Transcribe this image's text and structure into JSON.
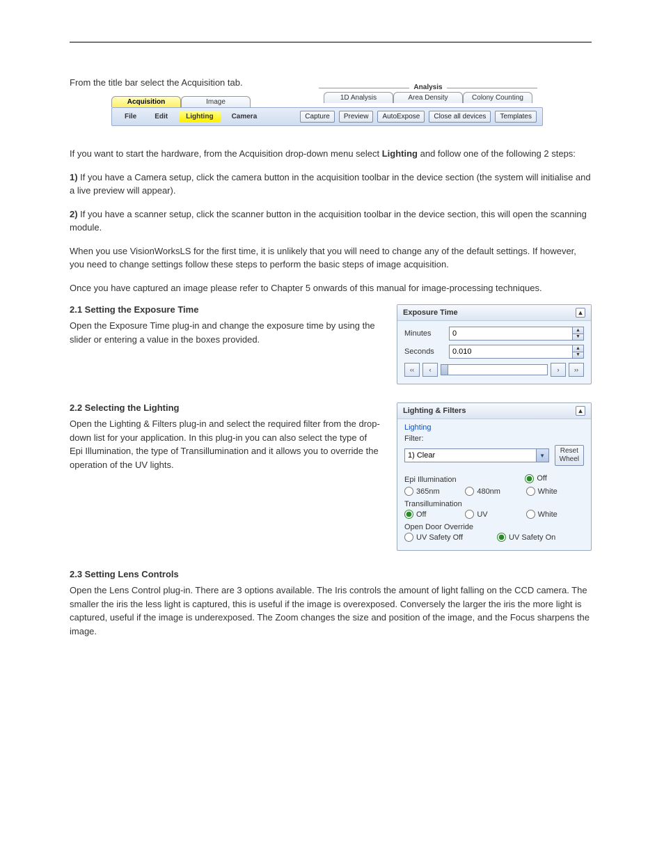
{
  "intro": "From the title bar select the Acquisition tab.",
  "toolbar": {
    "analysis_label": "Analysis",
    "tabs": {
      "acquisition": "Acquisition",
      "image": "Image",
      "analysis_1d": "1D Analysis",
      "area_density": "Area Density",
      "colony": "Colony Counting"
    },
    "menu": {
      "file": "File",
      "edit": "Edit",
      "lighting": "Lighting",
      "camera": "Camera"
    },
    "buttons": {
      "capture": "Capture",
      "preview": "Preview",
      "autoexp": "AutoExpose",
      "closeall": "Close all devices",
      "templates": "Templates"
    }
  },
  "after_toolbar": {
    "p1_a": "If you want to start the hardware, from the Acquisition drop-down menu select ",
    "p1_b": "Lighting",
    "p1_c": " and follow one of the following 2 steps:",
    "step1_bold": "1)",
    "step1_text": " If you have a Camera setup, click the camera button in the acquisition toolbar in the device section (the system will initialise and a live preview will appear).",
    "step2_bold": "2)",
    "step2_text": " If you have a scanner setup, click the scanner button in the acquisition toolbar in the device section, this will open the scanning module.",
    "para2": "When you use VisionWorksLS for the first time, it is unlikely that you will need to change any of the default settings. If however, you need to change settings follow these steps to perform the basic steps of image acquisition.",
    "para3": "Once you have captured an image please refer to Chapter 5 onwards of this manual for image-processing techniques."
  },
  "sec2_1": {
    "heading": "2.1 Setting the Exposure Time",
    "text": "Open the Exposure Time plug-in and change the exposure time by using the slider or entering a value in the boxes provided.",
    "panel_title": "Exposure Time",
    "minutes_label": "Minutes",
    "minutes_value": "0",
    "seconds_label": "Seconds",
    "seconds_value": "0.010"
  },
  "sec2_2": {
    "heading": "2.2 Selecting the Lighting",
    "text": "Open the Lighting & Filters plug-in and select the required filter from the drop-down list for your application. In this plug-in you can also select the type of Epi Illumination, the type of Transillumination and it allows you to override the operation of the UV lights.",
    "panel_title": "Lighting & Filters",
    "group_title": "Lighting",
    "filter_label": "Filter:",
    "filter_value": "1) Clear",
    "reset_btn": "Reset\nWheel",
    "epi_label": "Epi Illumination",
    "epi_365": "365nm",
    "epi_480": "480nm",
    "off": "Off",
    "white": "White",
    "trans_label": "Transillumination",
    "uv": "UV",
    "door_label": "Open Door Override",
    "uvsafety_off": "UV Safety Off",
    "uvsafety_on": "UV Safety On"
  },
  "sec2_3": {
    "heading": "2.3 Setting Lens Controls",
    "text": "Open the Lens Control plug-in. There are 3 options available. The Iris controls the amount of light falling on the CCD camera. The smaller the iris the less light is captured, this is useful if the image is overexposed. Conversely the larger the iris the more light is captured, useful if the image is underexposed. The Zoom changes the size and position of the image, and the Focus sharpens the image."
  }
}
